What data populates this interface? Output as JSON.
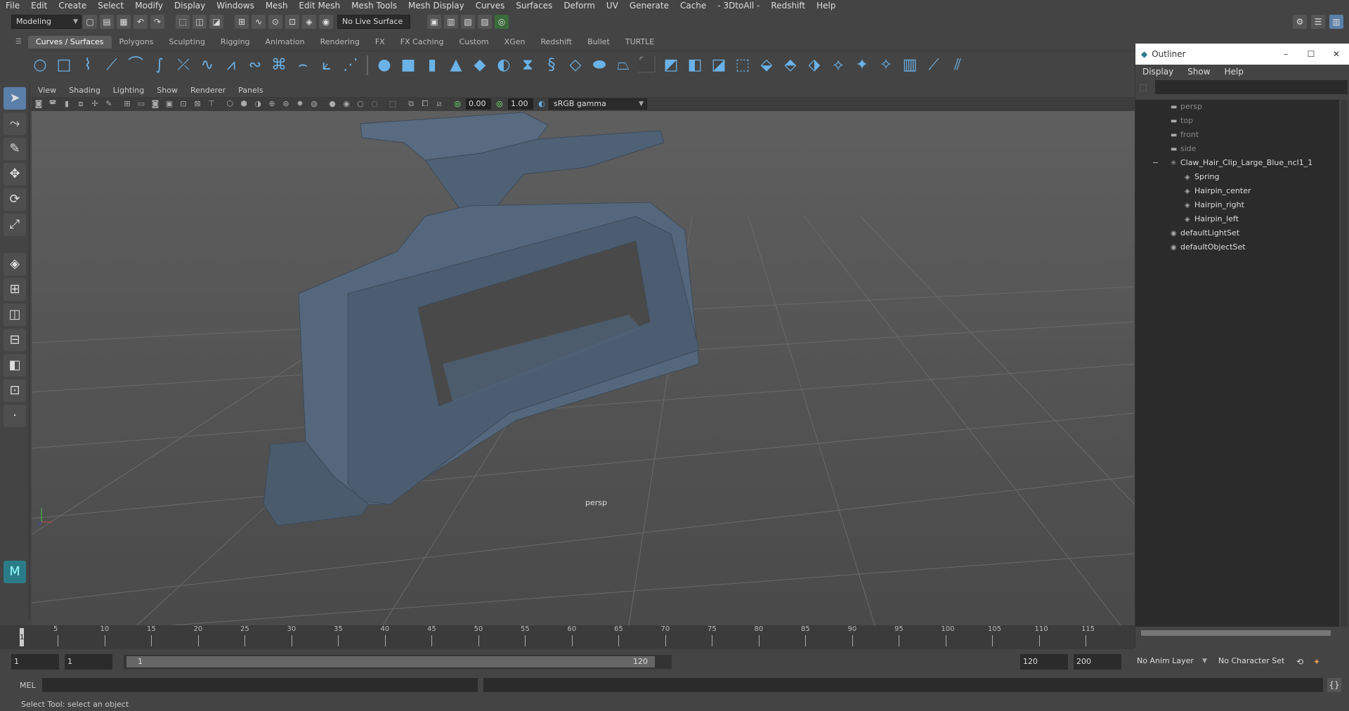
{
  "menu": [
    "File",
    "Edit",
    "Create",
    "Select",
    "Modify",
    "Display",
    "Windows",
    "Mesh",
    "Edit Mesh",
    "Mesh Tools",
    "Mesh Display",
    "Curves",
    "Surfaces",
    "Deform",
    "UV",
    "Generate",
    "Cache",
    "- 3DtoAll -",
    "Redshift",
    "Help"
  ],
  "status": {
    "mode": "Modeling",
    "live_surface": "No Live Surface"
  },
  "shelf_tabs": [
    "Curves / Surfaces",
    "Polygons",
    "Sculpting",
    "Rigging",
    "Animation",
    "Rendering",
    "FX",
    "FX Caching",
    "Custom",
    "XGen",
    "Redshift",
    "Bullet",
    "TURTLE"
  ],
  "shelf_active": "Curves / Surfaces",
  "panel_menu": [
    "View",
    "Shading",
    "Lighting",
    "Show",
    "Renderer",
    "Panels"
  ],
  "panel_tools": {
    "exposure": "0.00",
    "gamma": "1.00",
    "colorspace": "sRGB gamma"
  },
  "viewport": {
    "camera_label": "persp"
  },
  "timeline": {
    "ticks": [
      "5",
      "10",
      "15",
      "20",
      "25",
      "30",
      "35",
      "40",
      "45",
      "50",
      "55",
      "60",
      "65",
      "70",
      "75",
      "80",
      "85",
      "90",
      "95",
      "100",
      "105",
      "110",
      "115"
    ],
    "current_frame": "1"
  },
  "range": {
    "start": "1",
    "start2": "1",
    "slider_start": "1",
    "slider_end": "120",
    "end": "120",
    "end2": "200",
    "anim_layer": "No Anim Layer",
    "character_set": "No Character Set"
  },
  "cmd": {
    "lang": "MEL"
  },
  "help_line": "Select Tool: select an object",
  "outliner": {
    "title": "Outliner",
    "menu": [
      "Display",
      "Show",
      "Help"
    ],
    "items": [
      {
        "label": "persp",
        "indent": 1,
        "dim": true,
        "icon": "camera-icon"
      },
      {
        "label": "top",
        "indent": 1,
        "dim": true,
        "icon": "camera-icon"
      },
      {
        "label": "front",
        "indent": 1,
        "dim": true,
        "icon": "camera-icon"
      },
      {
        "label": "side",
        "indent": 1,
        "dim": true,
        "icon": "camera-icon"
      },
      {
        "label": "Claw_Hair_Clip_Large_Blue_ncl1_1",
        "indent": 1,
        "dim": false,
        "icon": "group-icon",
        "expander": "−"
      },
      {
        "label": "Spring",
        "indent": 2,
        "dim": false,
        "icon": "mesh-icon"
      },
      {
        "label": "Hairpin_center",
        "indent": 2,
        "dim": false,
        "icon": "mesh-icon"
      },
      {
        "label": "Hairpin_right",
        "indent": 2,
        "dim": false,
        "icon": "mesh-icon"
      },
      {
        "label": "Hairpin_left",
        "indent": 2,
        "dim": false,
        "icon": "mesh-icon"
      },
      {
        "label": "defaultLightSet",
        "indent": 1,
        "dim": false,
        "icon": "set-icon"
      },
      {
        "label": "defaultObjectSet",
        "indent": 1,
        "dim": false,
        "icon": "set-icon"
      }
    ]
  }
}
